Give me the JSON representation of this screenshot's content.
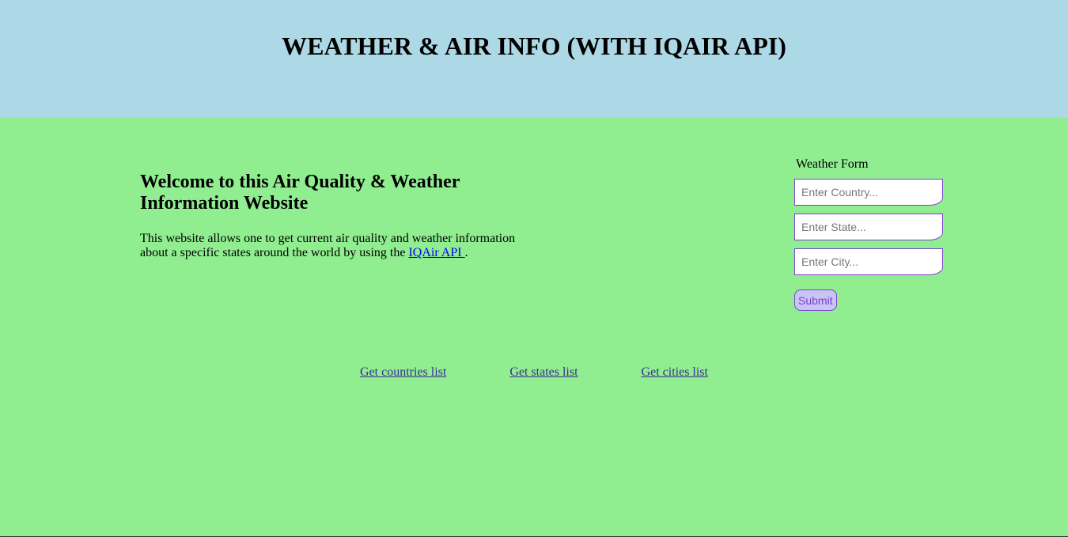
{
  "header": {
    "title": "WEATHER & AIR INFO (WITH IQAIR API)"
  },
  "intro": {
    "heading": "Welcome to this Air Quality & Weather Information Website",
    "text_before_link": "This website allows one to get current air quality and weather information about a specific states around the world by using the ",
    "link_text": "IQAir API ",
    "text_after_link": "."
  },
  "form": {
    "title": "Weather Form",
    "country_placeholder": "Enter Country...",
    "state_placeholder": "Enter State...",
    "city_placeholder": "Enter City...",
    "submit_label": "Submit"
  },
  "links": {
    "countries": "Get countries list",
    "states": "Get states list",
    "cities": "Get cities list"
  },
  "colors": {
    "header_bg": "#add8e6",
    "page_bg": "#90ee90",
    "accent": "#7b3fd0"
  }
}
